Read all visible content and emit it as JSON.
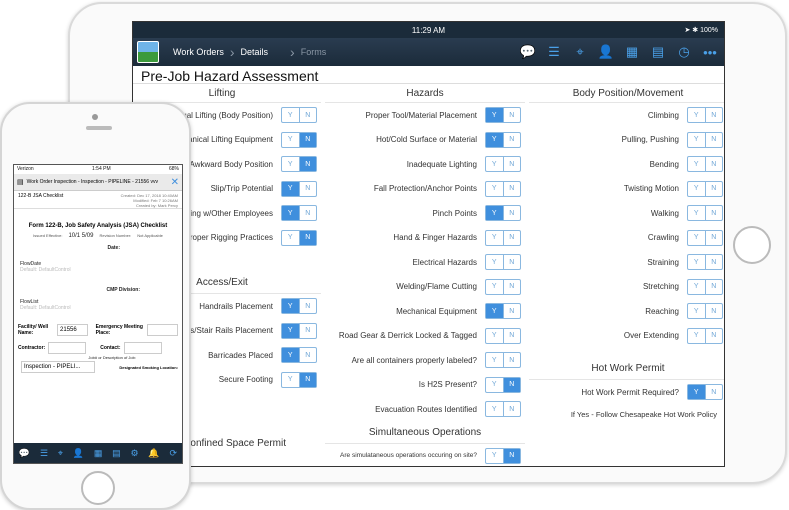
{
  "tablet": {
    "status_time": "11:29 AM",
    "status_right": "➤ ✱ 100%",
    "nav": {
      "crumb1": "Work Orders",
      "crumb2": "Details",
      "crumb3": "Forms"
    },
    "title": "Pre-Job Hazard Assessment",
    "lifting": {
      "heading": "Lifting",
      "rows": [
        {
          "label": "Manual Lifting (Body Position)",
          "selected": "none"
        },
        {
          "label": "Mechanical Lifting Equipment",
          "selected": "N"
        },
        {
          "label": "Awkward Body Position",
          "selected": "N"
        },
        {
          "label": "Slip/Trip Potential",
          "selected": "Y"
        },
        {
          "label": "Lifting w/Other Employees",
          "selected": "Y"
        },
        {
          "label": "Proper Rigging Practices",
          "selected": "N"
        }
      ]
    },
    "access": {
      "heading": "Access/Exit",
      "rows": [
        {
          "label": "Handrails Placement",
          "selected": "Y"
        },
        {
          "label": "Ladders/Stair Rails Placement",
          "selected": "Y"
        },
        {
          "label": "Barricades Placed",
          "selected": "Y"
        },
        {
          "label": "Secure Footing",
          "selected": "N"
        }
      ]
    },
    "confined_heading": "Confined Space Permit",
    "hazards": {
      "heading": "Hazards",
      "rows": [
        {
          "label": "Proper Tool/Material Placement",
          "selected": "Y"
        },
        {
          "label": "Hot/Cold Surface or Material",
          "selected": "Y"
        },
        {
          "label": "Inadequate Lighting",
          "selected": "none"
        },
        {
          "label": "Fall Protection/Anchor Points",
          "selected": "none"
        },
        {
          "label": "Pinch Points",
          "selected": "Y"
        },
        {
          "label": "Hand & Finger Hazards",
          "selected": "none"
        },
        {
          "label": "Electrical Hazards",
          "selected": "none"
        },
        {
          "label": "Welding/Flame Cutting",
          "selected": "none"
        },
        {
          "label": "Mechanical Equipment",
          "selected": "Y"
        },
        {
          "label": "Road Gear & Derrick Locked & Tagged",
          "selected": "none"
        },
        {
          "label": "Are all containers properly labeled?",
          "selected": "none"
        },
        {
          "label": "Is H2S Present?",
          "selected": "N"
        },
        {
          "label": "Evacuation Routes Identified",
          "selected": "none"
        }
      ]
    },
    "simultaneous": {
      "heading": "Simultaneous Operations",
      "question": "Are simulataneous operations occuring on site?",
      "selected": "N"
    },
    "body": {
      "heading": "Body Position/Movement",
      "rows": [
        {
          "label": "Climbing",
          "selected": "none"
        },
        {
          "label": "Pulling, Pushing",
          "selected": "none"
        },
        {
          "label": "Bending",
          "selected": "none"
        },
        {
          "label": "Twisting Motion",
          "selected": "none"
        },
        {
          "label": "Walking",
          "selected": "none"
        },
        {
          "label": "Crawling",
          "selected": "none"
        },
        {
          "label": "Straining",
          "selected": "none"
        },
        {
          "label": "Stretching",
          "selected": "none"
        },
        {
          "label": "Reaching",
          "selected": "none"
        },
        {
          "label": "Over Extending",
          "selected": "none"
        }
      ]
    },
    "hot_work": {
      "heading": "Hot Work Permit",
      "question": "Hot Work Permit Required?",
      "selected": "Y",
      "note": "If Yes - Follow Chesapeake Hot Work Policy"
    },
    "yes": "Y",
    "no": "N"
  },
  "phone": {
    "carrier": "Verizon",
    "time": "1:54 PM",
    "battery": "68%",
    "header": "Work Order Inspection - Inspection - PIPELINE - 21556 vvv",
    "form_id": "122-B JSA Checklist",
    "meta": "Created: Dec 17, 2018 10:40AM\nModified: Feb 7 10:26AM\nCreated by: Mark Percy",
    "form_title": "Form 122-B, Job Safety Analysis (JSA) Checklist",
    "issued_label": "Issued Effective:",
    "issued_value": "10/1 5/09",
    "revision_label": "Revision Number:",
    "revision_value": "Not Applicable",
    "date_label": "Date:",
    "flowdate": "FlowDate",
    "default1": "Default: DefaultControl",
    "cmp": "CMP Division:",
    "flowlist": "FlowList",
    "default2": "Default: DefaultControl",
    "facility_label": "Facility/ Well Name:",
    "facility_value": "21556",
    "emergency_label": "Emergency Meeting Place:",
    "contractor_label": "Contractor:",
    "contact_label": "Contact:",
    "job_label": "Job# or Description of Job:",
    "inspection_btn": "Inspection - PIPELI...",
    "smoking_label": "Designated Smoking Location:"
  }
}
